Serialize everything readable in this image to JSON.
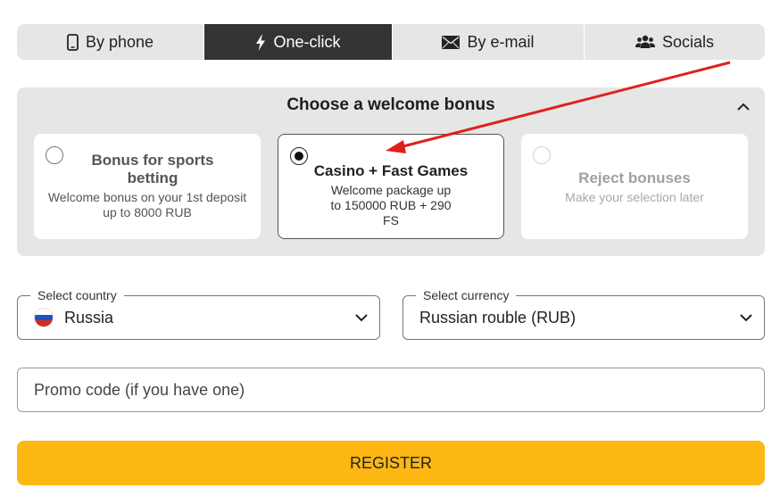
{
  "tabs": [
    {
      "label": "By phone",
      "icon": "phone-icon",
      "active": false
    },
    {
      "label": "One-click",
      "icon": "lightning-icon",
      "active": true
    },
    {
      "label": "By e-mail",
      "icon": "envelope-icon",
      "active": false
    },
    {
      "label": "Socials",
      "icon": "users-icon",
      "active": false
    }
  ],
  "bonus": {
    "title": "Choose a welcome bonus",
    "options": [
      {
        "title": "Bonus for sports betting",
        "description": "Welcome bonus on your 1st deposit up to 8000 RUB",
        "selected": false
      },
      {
        "title": "Casino + Fast Games",
        "description": "Welcome package up to 150000 RUB + 290 FS",
        "selected": true
      },
      {
        "title": "Reject bonuses",
        "description": "Make your selection later",
        "selected": false
      }
    ]
  },
  "country": {
    "legend": "Select country",
    "value": "Russia"
  },
  "currency": {
    "legend": "Select currency",
    "value": "Russian rouble (RUB)"
  },
  "promo": {
    "placeholder": "Promo code (if you have one)"
  },
  "register_label": "REGISTER",
  "colors": {
    "accent": "#fdb813",
    "active_tab": "#333333",
    "panel": "#e6e6e6",
    "annotation_arrow": "#e0201e"
  }
}
